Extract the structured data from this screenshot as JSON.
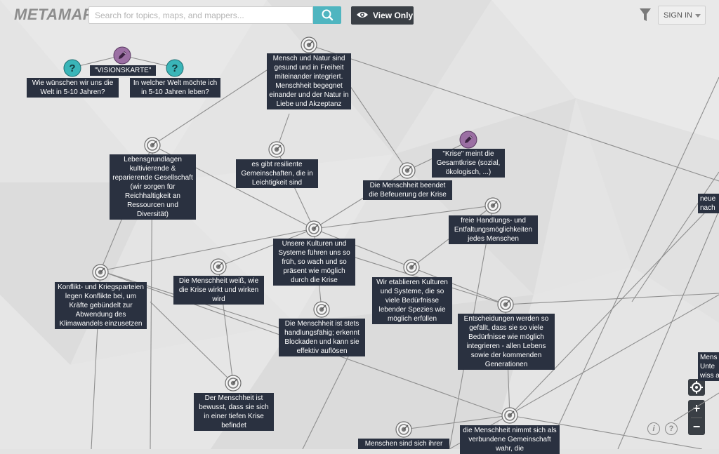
{
  "header": {
    "logo": "METAMAPS",
    "search_placeholder": "Search for topics, maps, and mappers...",
    "view_only_label": "View Only",
    "sign_in_label": "SIGN IN"
  },
  "colors": {
    "accent": "#4fb5c0",
    "label_bg": "#2a3140",
    "question_node": "#3ab5b8",
    "pen_node": "#9b6fa3",
    "button_dark": "#3a3f45"
  },
  "topics": [
    {
      "id": "vision",
      "icon": "pen-icon",
      "text": "\"VISIONSKARTE\""
    },
    {
      "id": "q1",
      "icon": "question-icon",
      "text": "Wie wünschen wir uns die Welt in 5-10 Jahren?"
    },
    {
      "id": "q2",
      "icon": "question-icon",
      "text": "In welcher Welt möchte ich in 5-10 Jahren leben?"
    },
    {
      "id": "natur",
      "icon": "target-icon",
      "text": "Mensch und Natur sind gesund und in Freiheit miteinander integriert. Menschheit begegnet einander und der Natur in Liebe und Akzeptanz"
    },
    {
      "id": "lebens",
      "icon": "target-icon",
      "text": "Lebensgrundlagen kultivierende & reparierende Gesellschaft (wir sorgen für Reichhaltigkeit an Ressourcen und Diversität)"
    },
    {
      "id": "resilient",
      "icon": "target-icon",
      "text": "es gibt resiliente Gemeinschaften, die in Leichtigkeit sind"
    },
    {
      "id": "krise",
      "icon": "pen-icon",
      "text": "\"Krise\" meint die Gesamtkrise (sozial, ökologisch, ...)"
    },
    {
      "id": "befeuerung",
      "icon": "target-icon",
      "text": "Die Menschheit beendet die Befeuerung der Krise"
    },
    {
      "id": "freie",
      "icon": "target-icon",
      "text": "freie Handlungs- und Entfaltungsmöglichkeiten jedes Menschen"
    },
    {
      "id": "kulturen",
      "icon": "target-icon",
      "text": "Unsere Kulturen und Systeme führen uns so früh, so wach und so präsent wie möglich durch die Krise"
    },
    {
      "id": "konflikt",
      "icon": "target-icon",
      "text": "Konflikt- und Kriegsparteien legen Konflikte bei, um Kräfte gebündelt zur Abwendung des Klimawandels einzusetzen"
    },
    {
      "id": "weiss",
      "icon": "target-icon",
      "text": "Die Menschheit weiß, wie die Krise wirkt und wirken wird"
    },
    {
      "id": "etablieren",
      "icon": "target-icon",
      "text": "Wir etablieren Kulturen und Systeme, die so viele Bedürfnisse lebender Spezies wie möglich erfüllen"
    },
    {
      "id": "handlung",
      "icon": "target-icon",
      "text": "Die Menschheit ist stets handlungsfähig; erkennt Blockaden und kann sie effektiv auflösen"
    },
    {
      "id": "entscheid",
      "icon": "target-icon",
      "text": "Entscheidungen werden so gefällt, dass sie so viele Bedürfnisse wie möglich integrieren - allen Lebens sowie der kommenden Generationen"
    },
    {
      "id": "bewusst",
      "icon": "target-icon",
      "text": "Der Menschheit ist bewusst, dass sie sich in einer tiefen Krise befindet"
    },
    {
      "id": "verbunden",
      "icon": "target-icon",
      "text": "die Menschheit nimmt sich als verbundene Gemeinschaft wahr, die"
    },
    {
      "id": "ihrer",
      "icon": "target-icon",
      "text": "Menschen sind sich ihrer"
    },
    {
      "id": "neue",
      "icon": "target-icon",
      "text": "neue nach"
    },
    {
      "id": "mensunter",
      "icon": "target-icon",
      "text": "Mens Unte wiss a"
    }
  ],
  "controls": {
    "center_icon": "crosshair-icon",
    "zoom_in": "+",
    "zoom_out": "−",
    "info_icon": "i",
    "help_icon": "?"
  }
}
